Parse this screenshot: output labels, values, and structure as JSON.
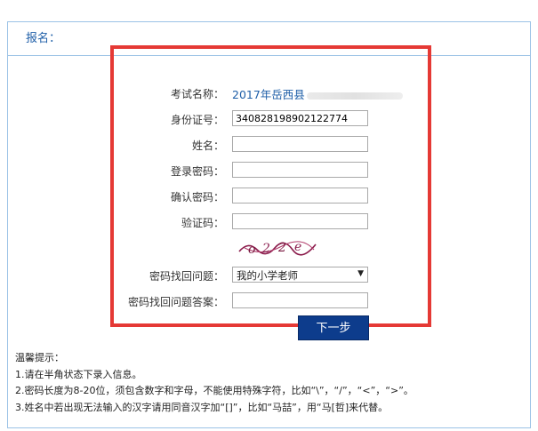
{
  "panel": {
    "title": "报名："
  },
  "form": {
    "exam_name_label": "考试名称：",
    "exam_name_value": "2017年岳西县",
    "id_label": "身份证号：",
    "id_value": "340828198902122774",
    "name_label": "姓名：",
    "password_label": "登录密码：",
    "confirm_label": "确认密码：",
    "captcha_label": "验证码：",
    "question_label": "密码找回问题：",
    "question_value": "我的小学老师",
    "answer_label": "密码找回问题答案：",
    "next_label": "下一步"
  },
  "tips": {
    "title": "温馨提示：",
    "line1": "1.请在半角状态下录入信息。",
    "line2": "2.密码长度为8-20位，须包含数字和字母，不能使用特殊字符，比如“\\”，“/”，“<”，“>”。",
    "line3": "3.姓名中若出现无法输入的汉字请用同音汉字加“[]”，比如“马喆”，用“马[哲]来代替。"
  },
  "colors": {
    "highlight": "#e53935",
    "button": "#0d3c8c",
    "border": "#9cc3e6",
    "link": "#1f5fa8"
  }
}
